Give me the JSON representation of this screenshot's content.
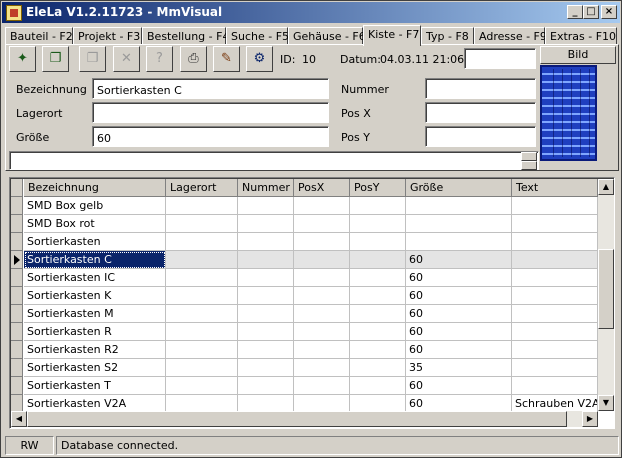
{
  "window": {
    "title": "EleLa V1.2.11723 - MmVisual"
  },
  "title_buttons": {
    "minimize": "_",
    "maximize": "□",
    "close": "×"
  },
  "tabs": [
    {
      "label": "Bauteil - F2"
    },
    {
      "label": "Projekt - F3"
    },
    {
      "label": "Bestellung - F4"
    },
    {
      "label": "Suche - F5"
    },
    {
      "label": "Gehäuse - F6"
    },
    {
      "label": "Kiste - F7"
    },
    {
      "label": "Typ - F8"
    },
    {
      "label": "Adresse - F9"
    },
    {
      "label": "Extras - F10"
    }
  ],
  "active_tab": "Kiste - F7",
  "toolbar": {
    "icons": [
      "new-icon",
      "copy-icon",
      "copy-disabled-icon",
      "delete-icon",
      "query-icon",
      "print-icon",
      "edit-icon",
      "network-icon"
    ],
    "glyphs": [
      "✦",
      "❐",
      "❐",
      "✕",
      "?",
      "⎙",
      "✎",
      "⚙"
    ]
  },
  "record": {
    "id_label": "ID:",
    "id_value": "10",
    "datum_label": "Datum:",
    "datum_value": "04.03.11 21:06",
    "bild_label": "Bild"
  },
  "form": {
    "bezeichnung_label": "Bezeichnung",
    "bezeichnung_value": "Sortierkasten C",
    "lagerort_label": "Lagerort",
    "lagerort_value": "",
    "groesse_label": "Größe",
    "groesse_value": "60",
    "nummer_label": "Nummer",
    "nummer_value": "",
    "posx_label": "Pos X",
    "posx_value": "",
    "posy_label": "Pos Y",
    "posy_value": ""
  },
  "grid": {
    "columns": [
      "Bezeichnung",
      "Lagerort",
      "Nummer",
      "PosX",
      "PosY",
      "Größe",
      "Text"
    ],
    "rows": [
      [
        "SMD Box gelb",
        "",
        "",
        "",
        "",
        "",
        ""
      ],
      [
        "SMD Box rot",
        "",
        "",
        "",
        "",
        "",
        ""
      ],
      [
        "Sortierkasten",
        "",
        "",
        "",
        "",
        "",
        ""
      ],
      [
        "Sortierkasten C",
        "",
        "",
        "",
        "",
        "60",
        ""
      ],
      [
        "Sortierkasten IC",
        "",
        "",
        "",
        "",
        "60",
        ""
      ],
      [
        "Sortierkasten K",
        "",
        "",
        "",
        "",
        "60",
        ""
      ],
      [
        "Sortierkasten M",
        "",
        "",
        "",
        "",
        "60",
        ""
      ],
      [
        "Sortierkasten R",
        "",
        "",
        "",
        "",
        "60",
        ""
      ],
      [
        "Sortierkasten R2",
        "",
        "",
        "",
        "",
        "60",
        ""
      ],
      [
        "Sortierkasten S2",
        "",
        "",
        "",
        "",
        "35",
        ""
      ],
      [
        "Sortierkasten T",
        "",
        "",
        "",
        "",
        "60",
        ""
      ],
      [
        "Sortierkasten V2A",
        "",
        "",
        "",
        "",
        "60",
        "Schrauben V2A"
      ]
    ],
    "selected_row": 3
  },
  "scroll": {
    "up": "▲",
    "down": "▼",
    "left": "◀",
    "right": "▶"
  },
  "status": {
    "mode": "RW",
    "message": "Database connected."
  },
  "colors": {
    "title_start": "#0a246a",
    "title_end": "#a6caf0",
    "selection": "#0a246a"
  }
}
